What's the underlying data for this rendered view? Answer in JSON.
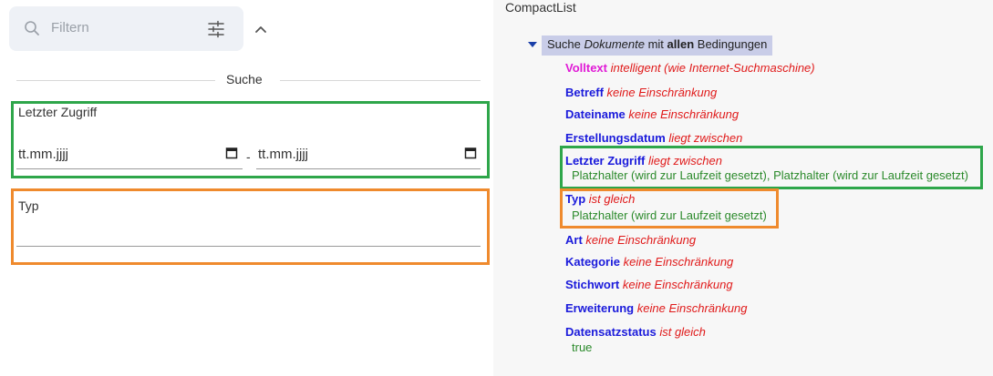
{
  "filter": {
    "placeholder": "Filtern",
    "search_icon": "search-icon",
    "tune_icon": "tune-icon",
    "collapse_icon": "chevron-up-icon"
  },
  "section": {
    "title": "Suche"
  },
  "last_access": {
    "label": "Letzter Zugriff",
    "from_placeholder": "tt.mm.jjjj",
    "separator": "-",
    "to_placeholder": "tt.mm.jjjj",
    "calendar_icon": "calendar-icon"
  },
  "type_field": {
    "label": "Typ",
    "value": ""
  },
  "highlight_colors": {
    "green": "#2ea64a",
    "orange": "#ef8a2d"
  },
  "compact_list": {
    "title": "CompactList",
    "root": {
      "prefix": "Suche ",
      "italic": "Dokumente",
      "middle": " mit ",
      "bold": "allen",
      "suffix": " Bedingungen"
    },
    "criteria": [
      {
        "name": "Volltext",
        "condition": "intelligent (wie Internet-Suchmaschine)",
        "value": ""
      },
      {
        "name": "Betreff",
        "condition": "keine Einschränkung",
        "value": ""
      },
      {
        "name": "Dateiname",
        "condition": "keine Einschränkung",
        "value": ""
      },
      {
        "name": "Erstellungsdatum",
        "condition": "liegt zwischen",
        "value": ""
      },
      {
        "name": "Letzter Zugriff",
        "condition": "liegt zwischen",
        "value": "Platzhalter (wird zur Laufzeit gesetzt), Platzhalter (wird zur Laufzeit gesetzt)"
      },
      {
        "name": "Typ",
        "condition": "ist gleich",
        "value": "Platzhalter (wird zur Laufzeit gesetzt)"
      },
      {
        "name": "Art",
        "condition": "keine Einschränkung",
        "value": ""
      },
      {
        "name": "Kategorie",
        "condition": "keine Einschränkung",
        "value": ""
      },
      {
        "name": "Stichwort",
        "condition": "keine Einschränkung",
        "value": ""
      },
      {
        "name": "Erweiterung",
        "condition": "keine Einschränkung",
        "value": ""
      },
      {
        "name": "Datensatzstatus",
        "condition": "ist gleich",
        "value": "true"
      }
    ]
  }
}
